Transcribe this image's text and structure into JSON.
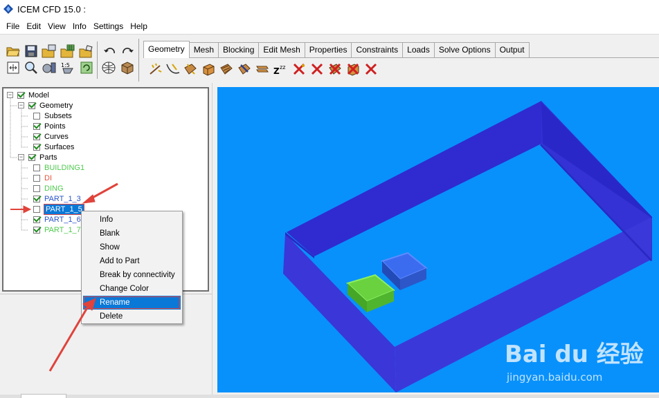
{
  "window": {
    "title": "ICEM CFD 15.0 :"
  },
  "menu": [
    "File",
    "Edit",
    "View",
    "Info",
    "Settings",
    "Help"
  ],
  "tabs": [
    {
      "label": "Geometry",
      "active": true
    },
    {
      "label": "Mesh",
      "active": false
    },
    {
      "label": "Blocking",
      "active": false
    },
    {
      "label": "Edit Mesh",
      "active": false
    },
    {
      "label": "Properties",
      "active": false
    },
    {
      "label": "Constraints",
      "active": false
    },
    {
      "label": "Loads",
      "active": false
    },
    {
      "label": "Solve Options",
      "active": false
    },
    {
      "label": "Output",
      "active": false
    }
  ],
  "toolbar": {
    "file_icons": [
      "open-folder-icon",
      "save-icon",
      "open-geometry-icon",
      "open-mesh-icon",
      "open-blocking-icon",
      "undo-icon",
      "redo-icon"
    ],
    "view_icons": [
      "fit-window-icon",
      "zoom-icon",
      "measure-icon",
      "display-tree-icon",
      "refresh-icon",
      "wireframe-icon",
      "solid-icon"
    ],
    "geometry_icons": [
      "create-point-icon",
      "create-curve-icon",
      "create-surface-icon",
      "create-body-icon",
      "faceted-icon",
      "repair-geometry-icon",
      "transform-geometry-icon",
      "restore-entities-icon",
      "delete-point-icon",
      "delete-curve-icon",
      "delete-surface-icon",
      "delete-body-icon",
      "delete-any-entity-icon"
    ]
  },
  "tree": {
    "model": "Model",
    "geometry": "Geometry",
    "subsets": "Subsets",
    "points": "Points",
    "curves": "Curves",
    "surfaces": "Surfaces",
    "parts": "Parts",
    "part_items": [
      {
        "label": "BUILDING1",
        "color": "#4ec94e",
        "checked": false
      },
      {
        "label": "DI",
        "color": "#e5533c",
        "checked": false
      },
      {
        "label": "DING",
        "color": "#4ec94e",
        "checked": false
      },
      {
        "label": "PART_1_3",
        "color": "#2a54c9",
        "checked": true
      },
      {
        "label": "PART_1_5",
        "color": "#ffffff",
        "checked": false,
        "selected": true
      },
      {
        "label": "PART_1_6",
        "color": "#2a54c9",
        "checked": true
      },
      {
        "label": "PART_1_7",
        "color": "#4ec94e",
        "checked": true
      }
    ]
  },
  "context_menu": [
    "Info",
    "Blank",
    "Show",
    "Add to Part",
    "Break by connectivity",
    "Change Color",
    "Rename",
    "Delete"
  ],
  "context_highlight": "Rename",
  "watermark": {
    "brand": "Bai du 经验",
    "url": "jingyan.baidu.com"
  },
  "colors": {
    "viewport_bg": "#0891fb",
    "walls": "#3a36d8",
    "green_block": "#6ad13f",
    "blue_block": "#2f5fd6",
    "selection": "#0a78d7",
    "arrow": "#e0433b"
  }
}
